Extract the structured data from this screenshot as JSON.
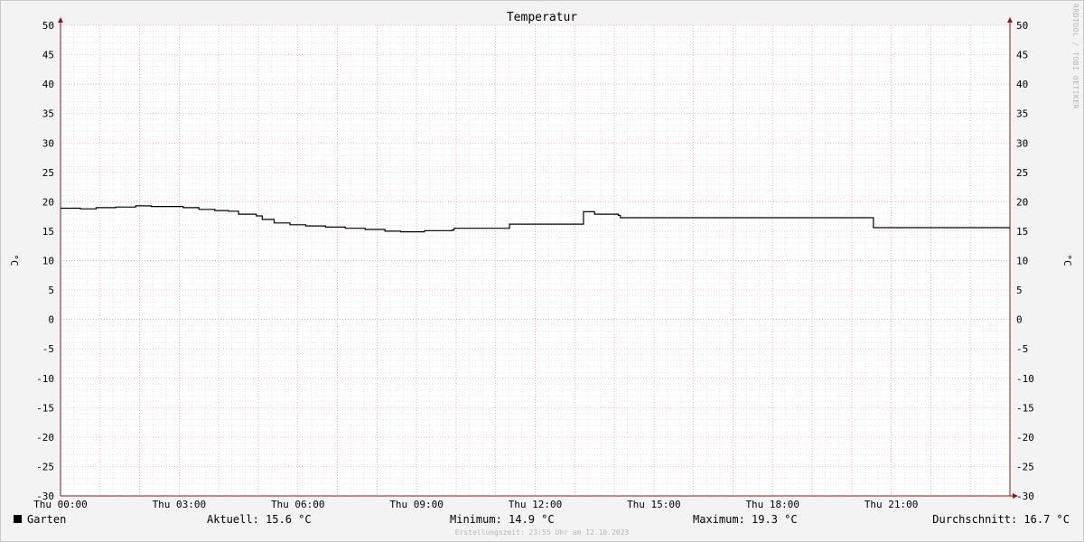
{
  "chart_data": {
    "type": "line",
    "title": "Temperatur",
    "ylabel": "°C",
    "ylabel_right": "°C",
    "ylim": [
      -30,
      50
    ],
    "ytick_step": 5,
    "xlim": [
      0,
      24
    ],
    "xticks": [
      {
        "x": 0,
        "label": "Thu 00:00"
      },
      {
        "x": 3,
        "label": "Thu 03:00"
      },
      {
        "x": 6,
        "label": "Thu 06:00"
      },
      {
        "x": 9,
        "label": "Thu 09:00"
      },
      {
        "x": 12,
        "label": "Thu 12:00"
      },
      {
        "x": 15,
        "label": "Thu 15:00"
      },
      {
        "x": 18,
        "label": "Thu 18:00"
      },
      {
        "x": 21,
        "label": "Thu 21:00"
      }
    ],
    "grid": true,
    "series": [
      {
        "name": "Garten",
        "color": "#000000",
        "points": [
          [
            0.0,
            18.9
          ],
          [
            0.5,
            18.8
          ],
          [
            0.9,
            19.0
          ],
          [
            1.4,
            19.1
          ],
          [
            1.9,
            19.3
          ],
          [
            2.3,
            19.2
          ],
          [
            2.7,
            19.2
          ],
          [
            3.1,
            19.0
          ],
          [
            3.5,
            18.7
          ],
          [
            3.9,
            18.5
          ],
          [
            4.25,
            18.4
          ],
          [
            4.5,
            17.9
          ],
          [
            4.95,
            17.6
          ],
          [
            5.1,
            17.0
          ],
          [
            5.4,
            16.4
          ],
          [
            5.8,
            16.1
          ],
          [
            6.2,
            15.9
          ],
          [
            6.7,
            15.7
          ],
          [
            7.2,
            15.5
          ],
          [
            7.7,
            15.3
          ],
          [
            8.2,
            15.0
          ],
          [
            8.6,
            14.9
          ],
          [
            9.1,
            14.9
          ],
          [
            9.2,
            15.1
          ],
          [
            9.9,
            15.2
          ],
          [
            9.95,
            15.5
          ],
          [
            11.3,
            15.5
          ],
          [
            11.35,
            16.2
          ],
          [
            13.2,
            16.2
          ],
          [
            13.22,
            18.3
          ],
          [
            13.5,
            17.9
          ],
          [
            14.1,
            17.7
          ],
          [
            14.15,
            17.3
          ],
          [
            20.5,
            17.3
          ],
          [
            20.55,
            15.6
          ],
          [
            24.0,
            15.6
          ]
        ]
      }
    ],
    "legend": {
      "series_label": "Garten",
      "current": "Aktuell: 15.6 °C",
      "minimum": "Minimum: 14.9 °C",
      "maximum": "Maximum: 19.3 °C",
      "average": "Durchschnitt: 16.7 °C"
    },
    "footer": "Erstellungszeit: 23:55 Uhr am 12.10.2023",
    "watermark": "RRDTOOL / TOBI OETIKER"
  }
}
